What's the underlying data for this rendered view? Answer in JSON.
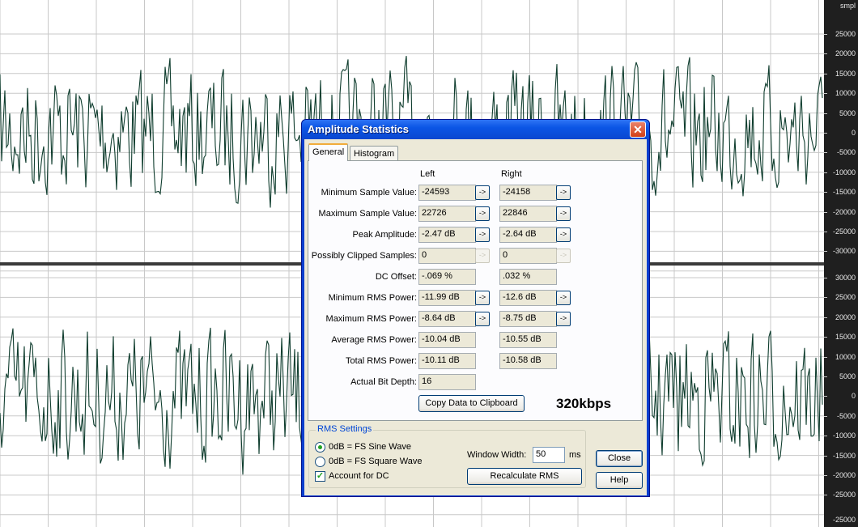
{
  "ruler": {
    "unit": "smpl",
    "top_channel_labels": [
      "25000",
      "20000",
      "15000",
      "10000",
      "5000",
      "0",
      "-5000",
      "-10000",
      "-15000",
      "-20000",
      "-25000",
      "-30000"
    ],
    "bottom_channel_labels": [
      "30000",
      "25000",
      "20000",
      "15000",
      "10000",
      "5000",
      "0",
      "-5000",
      "-10000",
      "-15000",
      "-20000",
      "-25000"
    ],
    "bottom_extra_label": "-25000"
  },
  "dialog": {
    "title": "Amplitude Statistics",
    "close_glyph": "✕",
    "tabs": [
      {
        "label": "General",
        "active": true
      },
      {
        "label": "Histogram",
        "active": false
      }
    ],
    "columns": {
      "left": "Left",
      "right": "Right"
    },
    "rows": [
      {
        "label": "Minimum Sample Value:",
        "left": "-24593",
        "right": "-24158",
        "button": "enabled"
      },
      {
        "label": "Maximum Sample Value:",
        "left": "22726",
        "right": "22846",
        "button": "enabled"
      },
      {
        "label": "Peak Amplitude:",
        "left": "-2.47 dB",
        "right": "-2.64 dB",
        "button": "enabled"
      },
      {
        "label": "Possibly Clipped Samples:",
        "left": "0",
        "right": "0",
        "button": "disabled"
      },
      {
        "label": "DC Offset:",
        "left": "-.069 %",
        "right": ".032 %",
        "button": "none"
      },
      {
        "label": "Minimum RMS Power:",
        "left": "-11.99 dB",
        "right": "-12.6 dB",
        "button": "enabled"
      },
      {
        "label": "Maximum RMS Power:",
        "left": "-8.64 dB",
        "right": "-8.75 dB",
        "button": "enabled"
      },
      {
        "label": "Average RMS Power:",
        "left": "-10.04 dB",
        "right": "-10.55 dB",
        "button": "none"
      },
      {
        "label": "Total RMS Power:",
        "left": "-10.11 dB",
        "right": "-10.58 dB",
        "button": "none"
      },
      {
        "label": "Actual Bit Depth:",
        "left": "16",
        "right": null,
        "button": "none"
      }
    ],
    "arrow_glyph": "->",
    "annotation": "320kbps",
    "copy_button": "Copy Data to Clipboard",
    "rms_settings": {
      "legend": "RMS Settings",
      "options": [
        {
          "label": "0dB = FS Sine Wave",
          "selected": true
        },
        {
          "label": "0dB = FS Square Wave",
          "selected": false
        }
      ],
      "account_dc": {
        "label": "Account for DC",
        "checked": true
      },
      "window_width_label": "Window Width:",
      "window_width_value": "50",
      "window_width_unit": "ms",
      "recalc_button": "Recalculate RMS"
    },
    "close_button": "Close",
    "help_button": "Help"
  },
  "colors": {
    "waveform": "#0f3d2e",
    "grid": "#c8c8c8",
    "ruler_bg": "#1f1f1f",
    "title_bar": "#0b55e5"
  }
}
